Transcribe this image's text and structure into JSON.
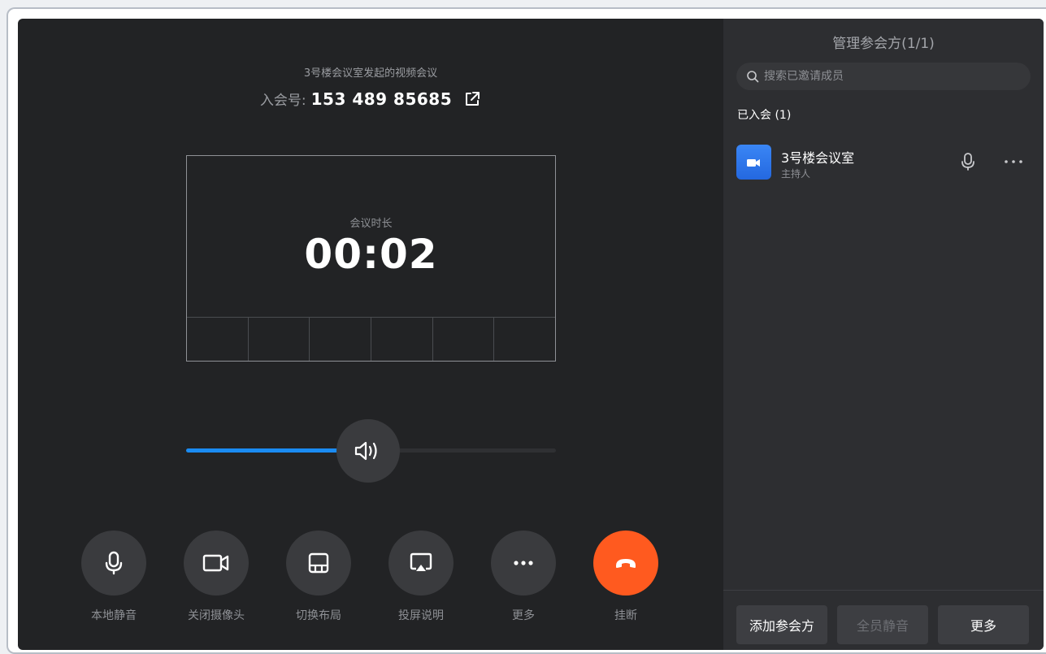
{
  "meeting": {
    "title": "3号楼会议室发起的视频会议",
    "id_label": "入会号:",
    "id_value": "153 489 85685",
    "duration_label": "会议时长",
    "duration_value": "00:02"
  },
  "volume": {
    "level": 0.41
  },
  "controls": [
    {
      "label": "本地静音",
      "icon": "mic-icon"
    },
    {
      "label": "关闭摄像头",
      "icon": "camera-icon"
    },
    {
      "label": "切换布局",
      "icon": "layout-icon"
    },
    {
      "label": "投屏说明",
      "icon": "screen-cast-icon"
    },
    {
      "label": "更多",
      "icon": "more-icon"
    },
    {
      "label": "挂断",
      "icon": "hang-up-icon"
    }
  ],
  "sidebar": {
    "title": "管理参会方(1/1)",
    "search_placeholder": "搜索已邀请成员",
    "joined_label": "已入会 (1)",
    "members": [
      {
        "name": "3号楼会议室",
        "role": "主持人"
      }
    ],
    "footer": {
      "add_label": "添加参会方",
      "mute_all_label": "全员静音",
      "more_label": "更多"
    }
  },
  "colors": {
    "accent": "#1a8bf2",
    "hangup": "#ff5a1f",
    "background": "#222325",
    "sidebar_bg": "#2d2e31"
  }
}
